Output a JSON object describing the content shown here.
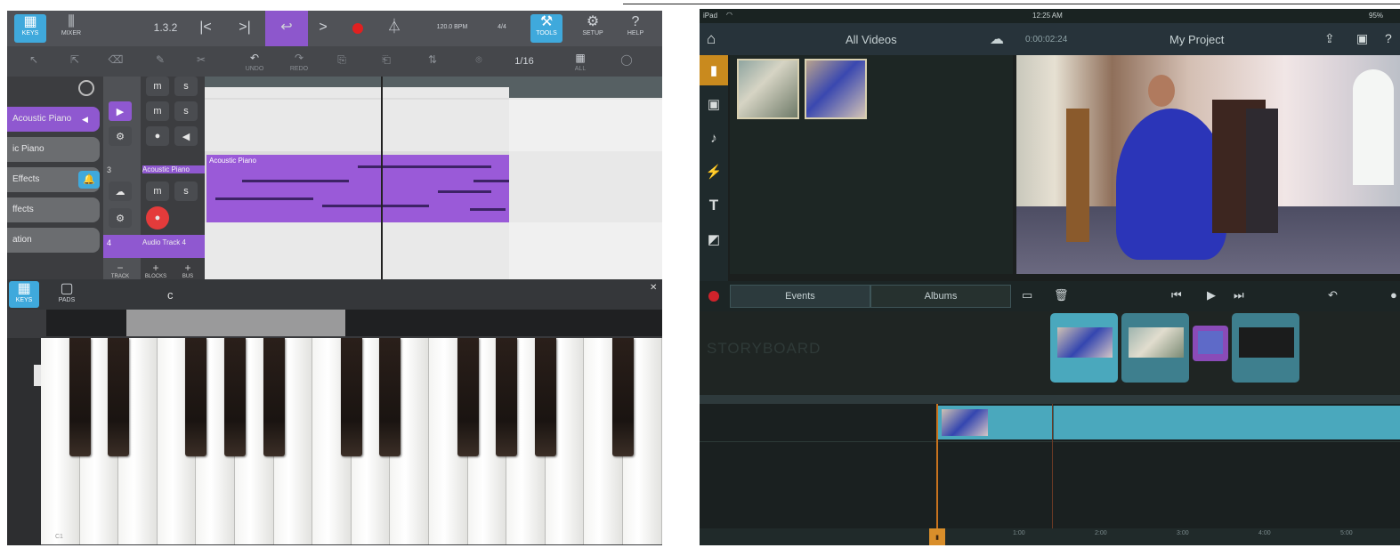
{
  "left_app": {
    "toolbar": {
      "keys_label": "KEYS",
      "mixer_label": "MIXER",
      "version": "1.3.2",
      "tempo": "120.0 BPM",
      "time_sig": "4/4",
      "tools_label": "TOOLS",
      "setup_label": "SETUP",
      "help_label": "HELP"
    },
    "edit_toolbar": {
      "undo_label": "UNDO",
      "redo_label": "REDO",
      "quantize_value": "1/16",
      "all_label": "ALL"
    },
    "tracks": [
      {
        "name": "Acoustic Piano"
      },
      {
        "name": "ic Piano"
      },
      {
        "name": "Effects"
      },
      {
        "name": "ffects"
      },
      {
        "name": "ation"
      }
    ],
    "track_rows": [
      {
        "number": "3",
        "label": "Acoustic Piano"
      },
      {
        "number": "4",
        "label": "Audio Track 4"
      }
    ],
    "bottom_controls": {
      "track": "TRACK",
      "blocks": "BLOCKS",
      "bus": "BUS"
    },
    "clip": {
      "name": "Acoustic Piano"
    },
    "keyboard": {
      "keys_label": "KEYS",
      "pads_label": "PADS",
      "octave_label": "c",
      "c_label": "C1"
    },
    "colors": {
      "accent": "#3fa9dc",
      "clip": "#9a5ad8",
      "track": "#8f58d0"
    }
  },
  "right_app": {
    "status_bar": {
      "device": "iPad",
      "time": "12:25 AM",
      "battery": "95%"
    },
    "header": {
      "all_videos": "All Videos",
      "timecode": "0:00:02:24",
      "project_title": "My Project"
    },
    "tabs": {
      "events": "Events",
      "albums": "Albums"
    },
    "storyboard_label": "STORYBOARD",
    "timeline_ticks": [
      "1:00",
      "2:00",
      "3:00",
      "4:00",
      "5:00"
    ],
    "colors": {
      "accent": "#4aa8bd",
      "record": "#d0232b"
    }
  }
}
